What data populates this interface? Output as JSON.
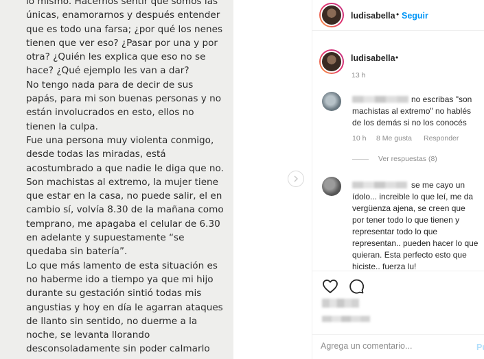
{
  "photo": {
    "paragraphs": [
      "lo mismo. Hacernos sentir que somos las únicas, enamorarnos y después entender que es todo una farsa; ¿por qué los nenes tienen que ver eso? ¿Pasar por una y por otra? ¿Quién les explica que eso no se hace? ¿Qué ejemplo les van a dar?",
      " No tengo nada para de decir de sus papás, para mi son buenas personas y no están involucrados en esto, ellos no tienen la culpa.",
      "Fue una persona muy violenta conmigo, desde todas las miradas, está acostumbrado a que nadie le diga que no. Son machistas al extremo, la mujer tiene que estar en la casa, no puede salir, el en cambio sí, volvía 8.30 de la mañana como temprano, me apagaba el celular de 6.30 en adelante y supuestamente “se quedaba sin batería”.",
      "Lo que más lamento de esta situación es no haberme ido a tiempo ya que mi hijo durante su gestación sintió todas mis angustias y hoy en día le agarran ataques de llanto sin sentido, no duerme a la noche, se levanta llorando desconsoladamente sin poder calmarlo"
    ]
  },
  "header": {
    "username": "ludisabella",
    "separator": "•",
    "follow_label": "Seguir"
  },
  "caption": {
    "username": "ludisabella",
    "separator": "•",
    "time": "13 h"
  },
  "comments": [
    {
      "text": "no escribas \"son machistas al extremo\" no hablés de los demás si no los conocés",
      "time": "10 h",
      "likes": "8 Me gusta",
      "reply_label": "Responder",
      "view_replies": "Ver respuestas (8)"
    },
    {
      "text": "se me cayo un ídolo... increible lo que leí, me da vergüenza ajena, se creen que por tener todo lo que tienen y representar todo lo que representan.. pueden hacer lo que quieran. Esta perfecto esto que hiciste.. fuerza lu!"
    }
  ],
  "comment_box": {
    "placeholder": "Agrega un comentario...",
    "publish_label": "Pu"
  },
  "icons": [
    "chevron-right-icon",
    "heart-icon",
    "comment-icon"
  ],
  "colors": {
    "accent": "#0095f6",
    "muted": "#8e8e8e",
    "text": "#262626"
  }
}
